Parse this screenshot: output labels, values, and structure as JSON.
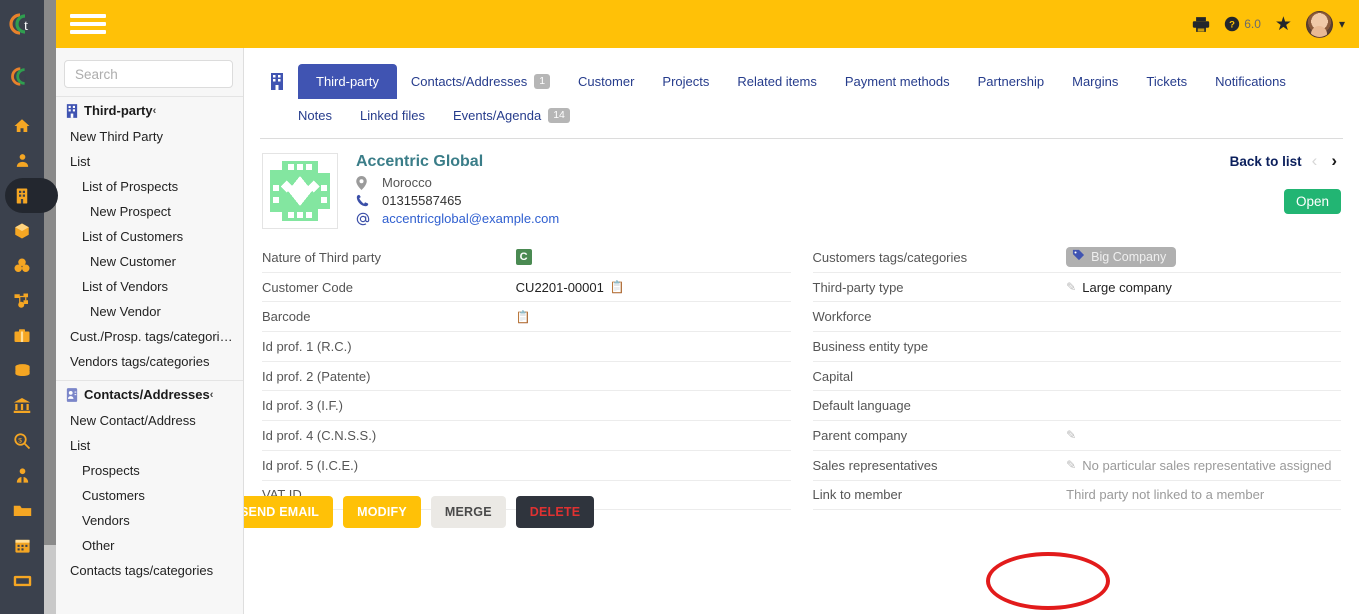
{
  "topbar": {
    "menu_icon": "hamburger-icon",
    "print_icon": "printer-icon",
    "help_icon": "help-circle-icon",
    "version": "6.0",
    "bookmark_icon": "star-icon",
    "avatar_icon": "user-avatar",
    "dropdown_icon": "chevron-down-icon"
  },
  "rail": {
    "logo_text": "t",
    "items": [
      {
        "name": "home",
        "glyph": "🏠"
      },
      {
        "name": "members",
        "glyph": "👤"
      },
      {
        "name": "third-parties",
        "glyph": "🏢"
      },
      {
        "name": "products",
        "glyph": "📦"
      },
      {
        "name": "mrp",
        "glyph": "⚙"
      },
      {
        "name": "projects",
        "glyph": "⚯"
      },
      {
        "name": "commercial",
        "glyph": "💼"
      },
      {
        "name": "billing",
        "glyph": "💵"
      },
      {
        "name": "bank",
        "glyph": "🏛"
      },
      {
        "name": "accounting",
        "glyph": "🔍"
      },
      {
        "name": "hrm",
        "glyph": "👤"
      },
      {
        "name": "documents",
        "glyph": "📁"
      },
      {
        "name": "agenda",
        "glyph": "📅"
      },
      {
        "name": "ticket",
        "glyph": "🎫"
      }
    ]
  },
  "search": {
    "placeholder": "Search",
    "value": "",
    "caret_icon": "chevron-down-icon"
  },
  "menu": {
    "groups": [
      {
        "title": "Third-party",
        "icon": "building-icon",
        "collapse_icon": "‹",
        "items": [
          {
            "label": "New Third Party",
            "level": 1
          },
          {
            "label": "List",
            "level": 1
          },
          {
            "label": "List of Prospects",
            "level": 2
          },
          {
            "label": "New Prospect",
            "level": 2
          },
          {
            "label": "List of Customers",
            "level": 2
          },
          {
            "label": "New Customer",
            "level": 2
          },
          {
            "label": "List of Vendors",
            "level": 2
          },
          {
            "label": "New Vendor",
            "level": 2
          },
          {
            "label": "Cust./Prosp. tags/categories",
            "level": 1
          },
          {
            "label": "Vendors tags/categories",
            "level": 1
          }
        ]
      },
      {
        "title": "Contacts/Addresses",
        "icon": "contact-card-icon",
        "collapse_icon": "‹",
        "items": [
          {
            "label": "New Contact/Address",
            "level": 1
          },
          {
            "label": "List",
            "level": 1
          },
          {
            "label": "Prospects",
            "level": 2
          },
          {
            "label": "Customers",
            "level": 2
          },
          {
            "label": "Vendors",
            "level": 2
          },
          {
            "label": "Other",
            "level": 2
          },
          {
            "label": "Contacts tags/categories",
            "level": 1
          }
        ]
      }
    ]
  },
  "tabs": {
    "icon": "building-icon",
    "row1": [
      {
        "label": "Third-party",
        "active": true,
        "badge": ""
      },
      {
        "label": "Contacts/Addresses",
        "active": false,
        "badge": "1"
      },
      {
        "label": "Customer",
        "active": false,
        "badge": ""
      },
      {
        "label": "Projects",
        "active": false,
        "badge": ""
      },
      {
        "label": "Related items",
        "active": false,
        "badge": ""
      },
      {
        "label": "Payment methods",
        "active": false,
        "badge": ""
      },
      {
        "label": "Partnership",
        "active": false,
        "badge": ""
      },
      {
        "label": "Margins",
        "active": false,
        "badge": ""
      },
      {
        "label": "Tickets",
        "active": false,
        "badge": ""
      },
      {
        "label": "Notifications",
        "active": false,
        "badge": ""
      }
    ],
    "row2": [
      {
        "label": "Notes",
        "active": false,
        "badge": ""
      },
      {
        "label": "Linked files",
        "active": false,
        "badge": ""
      },
      {
        "label": "Events/Agenda",
        "active": false,
        "badge": "14"
      }
    ]
  },
  "company": {
    "logo_icon": "company-logo-green-pattern",
    "name": "Accentric Global",
    "country": "Morocco",
    "country_icon": "location-pin-icon",
    "phone": "01315587465",
    "phone_icon": "phone-icon",
    "email": "accentricglobal@example.com",
    "email_icon": "at-icon"
  },
  "nav": {
    "back_to_list": "Back to list",
    "prev_icon": "‹",
    "next_icon": "›",
    "open_label": "Open"
  },
  "left_fields": [
    {
      "label": "Nature of Third party",
      "value": "C",
      "kind": "chip"
    },
    {
      "label": "Customer Code",
      "value": "CU2201-00001",
      "kind": "copy"
    },
    {
      "label": "Barcode",
      "value": "",
      "kind": "copy"
    },
    {
      "label": "Id prof. 1 (R.C.)",
      "value": "",
      "kind": "text"
    },
    {
      "label": "Id prof. 2 (Patente)",
      "value": "",
      "kind": "text"
    },
    {
      "label": "Id prof. 3 (I.F.)",
      "value": "",
      "kind": "text"
    },
    {
      "label": "Id prof. 4 (C.N.S.S.)",
      "value": "",
      "kind": "text"
    },
    {
      "label": "Id prof. 5 (I.C.E.)",
      "value": "",
      "kind": "text"
    },
    {
      "label": "VAT ID",
      "value": "",
      "kind": "text"
    }
  ],
  "right_fields": [
    {
      "label": "Customers tags/categories",
      "value": "Big Company",
      "kind": "tag"
    },
    {
      "label": "Third-party type",
      "value": "Large company",
      "kind": "edit"
    },
    {
      "label": "Workforce",
      "value": "",
      "kind": "text"
    },
    {
      "label": "Business entity type",
      "value": "",
      "kind": "text"
    },
    {
      "label": "Capital",
      "value": "",
      "kind": "text"
    },
    {
      "label": "Default language",
      "value": "",
      "kind": "text"
    },
    {
      "label": "Parent company",
      "value": "",
      "kind": "edit"
    },
    {
      "label": "Sales representatives",
      "value": "No particular sales representative assigned",
      "kind": "edit-muted"
    },
    {
      "label": "Link to member",
      "value": "Third party not linked to a member",
      "kind": "muted"
    }
  ],
  "actions": [
    {
      "label": "SEND EMAIL",
      "style": "amber",
      "highlight": true
    },
    {
      "label": "MODIFY",
      "style": "amber",
      "highlight": false
    },
    {
      "label": "MERGE",
      "style": "grey",
      "highlight": false
    },
    {
      "label": "DELETE",
      "style": "dark",
      "highlight": false
    }
  ],
  "colors": {
    "topbar": "#ffc107",
    "rail": "#3b414d",
    "accent": "#4054b2",
    "company_name": "#3a7d88",
    "open_button": "#22b573",
    "delete_text": "#e03131",
    "annotation": "#e21b1b",
    "logo_green": "#83e6a0"
  }
}
